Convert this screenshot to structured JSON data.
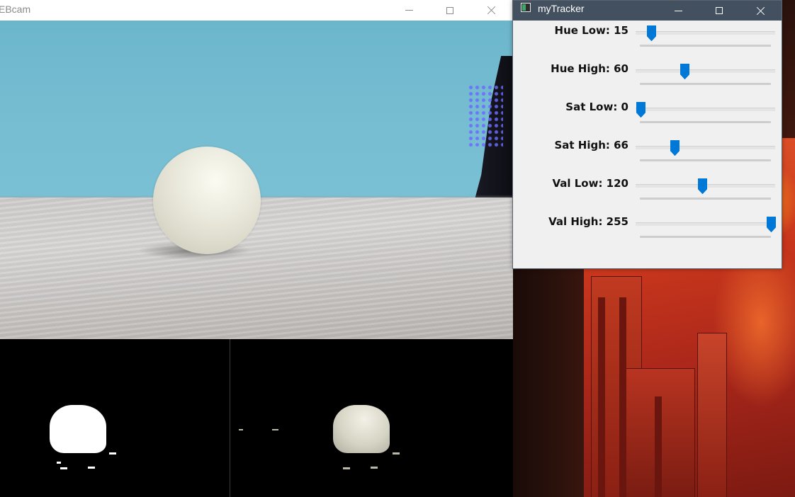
{
  "webcam_window": {
    "title": "EBcam"
  },
  "tracker_window": {
    "title": "myTracker",
    "accent_color": "#0078d7",
    "sliders": [
      {
        "label": "Hue Low: 15",
        "name": "Hue Low",
        "value": 15,
        "max": 179
      },
      {
        "label": "Hue High: 60",
        "name": "Hue High",
        "value": 60,
        "max": 179
      },
      {
        "label": "Sat Low: 0",
        "name": "Sat Low",
        "value": 0,
        "max": 255
      },
      {
        "label": "Sat High: 66",
        "name": "Sat High",
        "value": 66,
        "max": 255
      },
      {
        "label": "Val Low: 120",
        "name": "Val Low",
        "value": 120,
        "max": 255
      },
      {
        "label": "Val High: 255",
        "name": "Val High",
        "value": 255,
        "max": 255
      }
    ]
  },
  "icons": {
    "minimize": "minimize-icon",
    "maximize": "maximize-icon",
    "close": "close-icon",
    "app": "tracker-app-icon"
  }
}
